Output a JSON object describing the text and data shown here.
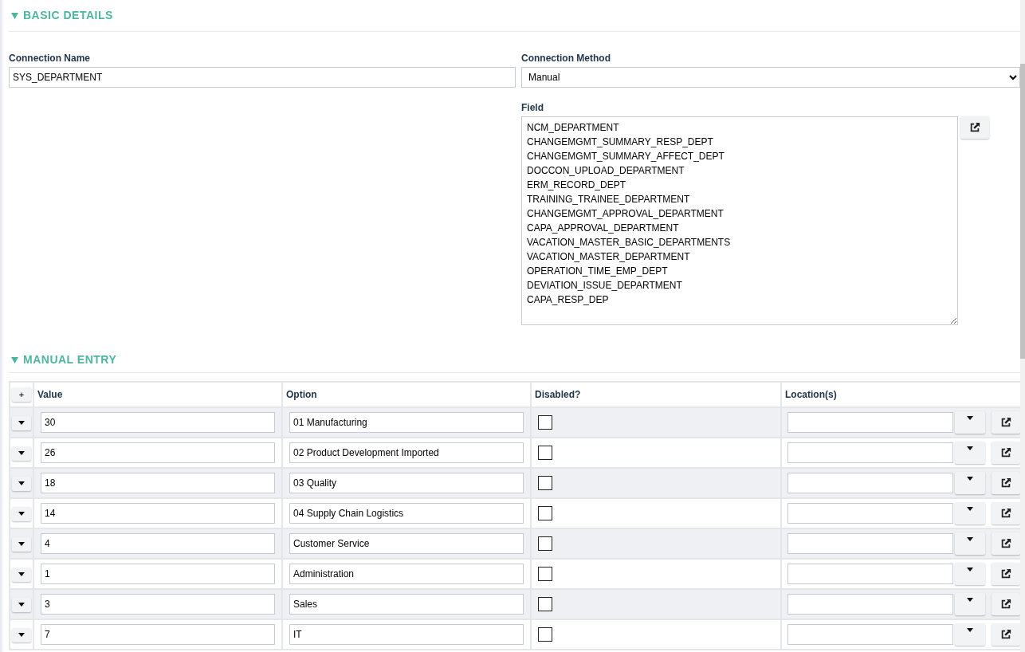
{
  "basic_details": {
    "title": "BASIC DETAILS",
    "expanded": true,
    "connection_name": {
      "label": "Connection Name",
      "value": "SYS_DEPARTMENT"
    },
    "connection_method": {
      "label": "Connection Method",
      "value": "Manual"
    },
    "field": {
      "label": "Field",
      "lines": [
        "NCM_DEPARTMENT",
        "CHANGEMGMT_SUMMARY_RESP_DEPT",
        "CHANGEMGMT_SUMMARY_AFFECT_DEPT",
        "DOCCON_UPLOAD_DEPARTMENT",
        "ERM_RECORD_DEPT",
        "TRAINING_TRAINEE_DEPARTMENT",
        "CHANGEMGMT_APPROVAL_DEPARTMENT",
        "CAPA_APPROVAL_DEPARTMENT",
        "VACATION_MASTER_BASIC_DEPARTMENTS",
        "VACATION_MASTER_DEPARTMENT",
        "OPERATION_TIME_EMP_DEPT",
        "DEVIATION_ISSUE_DEPARTMENT",
        "CAPA_RESP_DEP"
      ]
    }
  },
  "manual_entry": {
    "title": "MANUAL ENTRY",
    "expanded": true,
    "add_button": "+",
    "columns": [
      "Value",
      "Option",
      "Disabled?",
      "Location(s)"
    ],
    "rows": [
      {
        "value": "30",
        "option": "01 Manufacturing",
        "disabled": false,
        "location": ""
      },
      {
        "value": "26",
        "option": "02 Product Development Imported",
        "disabled": false,
        "location": ""
      },
      {
        "value": "18",
        "option": "03 Quality",
        "disabled": false,
        "location": ""
      },
      {
        "value": "14",
        "option": "04 Supply Chain Logistics",
        "disabled": false,
        "location": ""
      },
      {
        "value": "4",
        "option": "Customer Service",
        "disabled": false,
        "location": ""
      },
      {
        "value": "1",
        "option": "Administration",
        "disabled": false,
        "location": ""
      },
      {
        "value": "3",
        "option": "Sales",
        "disabled": false,
        "location": ""
      },
      {
        "value": "7",
        "option": "IT",
        "disabled": false,
        "location": ""
      }
    ]
  }
}
